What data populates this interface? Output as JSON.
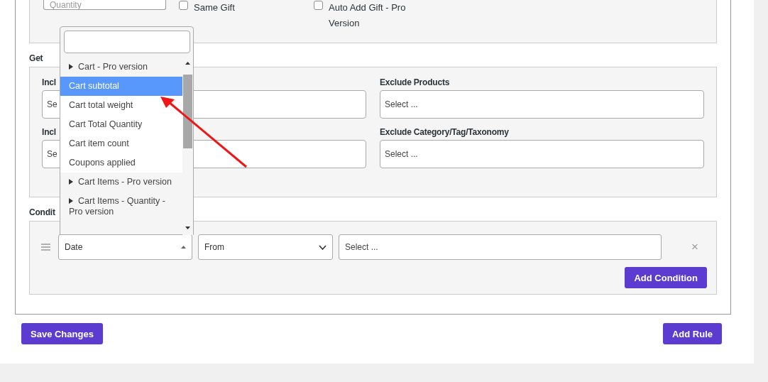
{
  "top_row": {
    "quantity_field": {
      "placeholder": "Quantity"
    },
    "checkboxes": [
      {
        "label": "Same Gift",
        "checked": false
      },
      {
        "label": "Auto Add Gift - Pro Version",
        "checked": false
      }
    ]
  },
  "get": {
    "title": "Get",
    "fields": [
      {
        "label": "Incl",
        "placeholder": "Se"
      },
      {
        "label": "Exclude Products",
        "placeholder": "Select ..."
      },
      {
        "label": "Incl",
        "placeholder": "Se"
      },
      {
        "label": "Exclude Category/Tag/Taxonomy",
        "placeholder": "Select ..."
      }
    ]
  },
  "dropdown": {
    "items": [
      {
        "kind": "group",
        "label": "Cart - Pro version",
        "selected": false
      },
      {
        "kind": "option",
        "label": "Cart subtotal",
        "selected": true
      },
      {
        "kind": "option",
        "label": "Cart total weight",
        "selected": false
      },
      {
        "kind": "option",
        "label": "Cart Total Quantity",
        "selected": false
      },
      {
        "kind": "option",
        "label": "Cart item count",
        "selected": false
      },
      {
        "kind": "option",
        "label": "Coupons applied",
        "selected": false
      },
      {
        "kind": "group",
        "label": "Cart Items - Pro version",
        "selected": false
      },
      {
        "kind": "group",
        "label": "Cart Items - Quantity - Pro version",
        "selected": false
      }
    ]
  },
  "conditions": {
    "title": "Condit",
    "row": {
      "type": "Date",
      "operator": "From",
      "value_placeholder": "Select ..."
    },
    "remove": "×",
    "add_button": "Add Condition"
  },
  "footer": {
    "save": "Save Changes",
    "add_rule": "Add Rule"
  }
}
